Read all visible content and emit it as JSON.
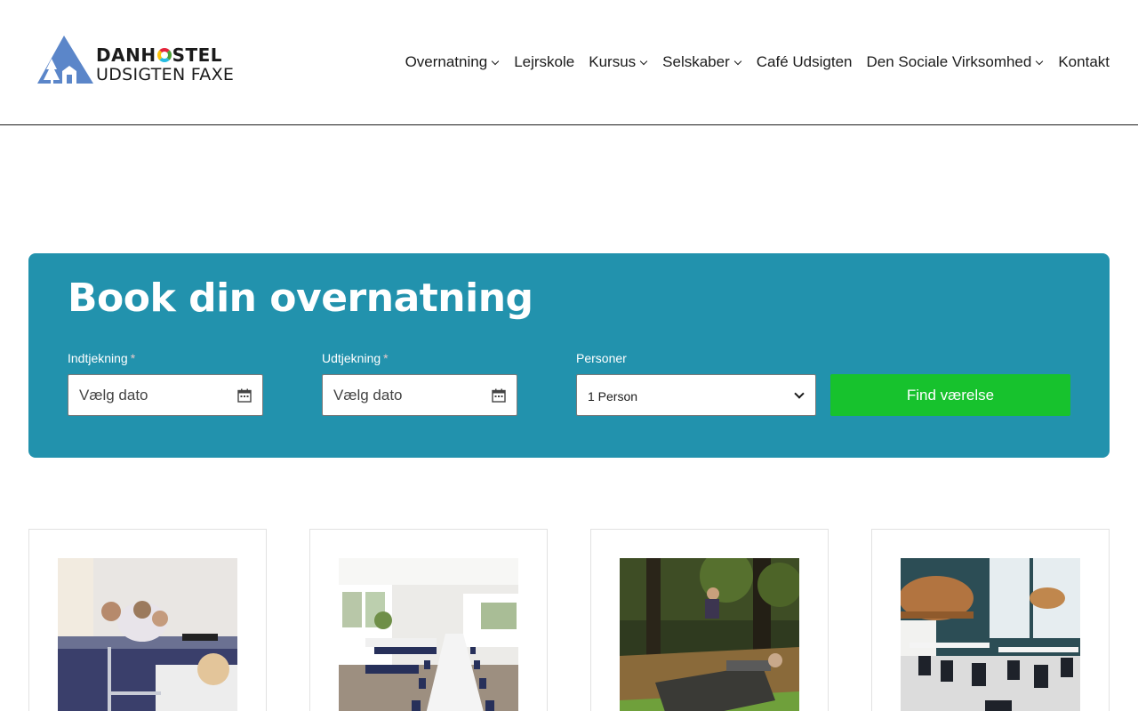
{
  "header": {
    "logo": {
      "brand_line1_a": "DANH",
      "brand_line1_b": "STEL",
      "brand_line2": "UDSIGTEN FAXE"
    },
    "nav": [
      {
        "label": "Overnatning",
        "has_dropdown": true
      },
      {
        "label": "Lejrskole",
        "has_dropdown": false
      },
      {
        "label": "Kursus",
        "has_dropdown": true
      },
      {
        "label": "Selskaber",
        "has_dropdown": true
      },
      {
        "label": "Café Udsigten",
        "has_dropdown": false
      },
      {
        "label": "Den Sociale Virksomhed",
        "has_dropdown": true
      },
      {
        "label": "Kontakt",
        "has_dropdown": false
      }
    ]
  },
  "booking": {
    "title": "Book din overnatning",
    "checkin": {
      "label": "Indtjekning",
      "required_mark": "*",
      "placeholder": "Vælg dato",
      "icon": "calendar-icon"
    },
    "checkout": {
      "label": "Udtjekning",
      "required_mark": "*",
      "placeholder": "Vælg dato",
      "icon": "calendar-icon"
    },
    "persons": {
      "label": "Personer",
      "value": "1 Person"
    },
    "submit_label": "Find værelse"
  },
  "cards": [
    {
      "image": "bunk-bed-room-photo"
    },
    {
      "image": "banquet-hall-photo"
    },
    {
      "image": "outdoor-play-photo"
    },
    {
      "image": "cafe-interior-photo"
    }
  ],
  "colors": {
    "panel": "#2292ad",
    "button": "#17c22d",
    "logo_blue": "#5b86c9"
  }
}
